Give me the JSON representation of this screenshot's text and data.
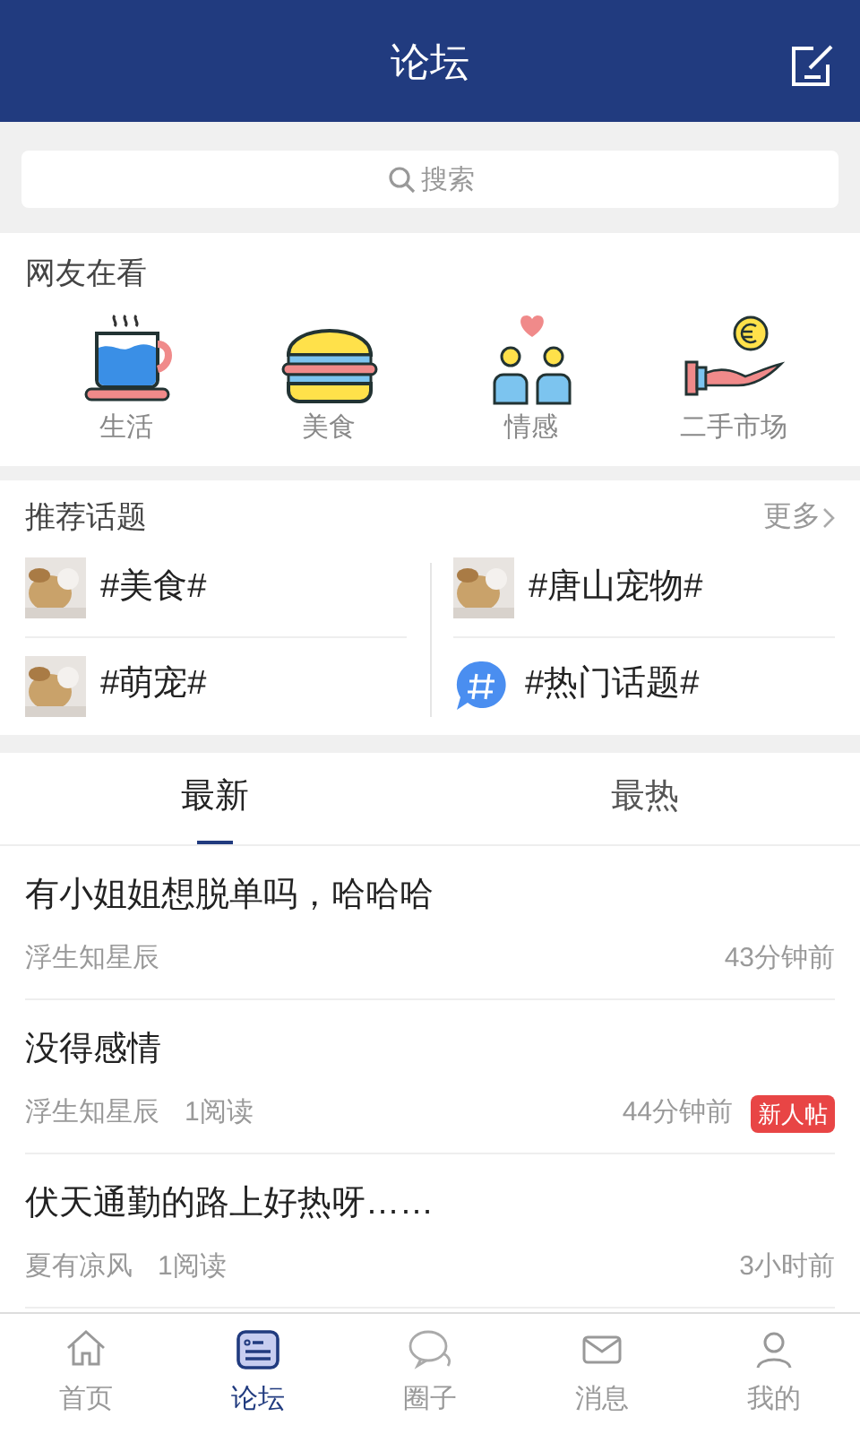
{
  "header": {
    "title": "论坛"
  },
  "search": {
    "placeholder": "搜索"
  },
  "watching": {
    "title": "网友在看",
    "items": [
      {
        "label": "生活",
        "kind": "cup"
      },
      {
        "label": "美食",
        "kind": "burger"
      },
      {
        "label": "情感",
        "kind": "couple"
      },
      {
        "label": "二手市场",
        "kind": "coin"
      }
    ]
  },
  "topics": {
    "title": "推荐话题",
    "more": "更多",
    "items": [
      {
        "label": "#美食#",
        "kind": "picture"
      },
      {
        "label": "#唐山宠物#",
        "kind": "picture"
      },
      {
        "label": "#萌宠#",
        "kind": "picture"
      },
      {
        "label": "#热门话题#",
        "kind": "hash"
      }
    ]
  },
  "tabs": [
    {
      "label": "最新",
      "selected": true
    },
    {
      "label": "最热",
      "selected": false
    }
  ],
  "posts": [
    {
      "title": "有小姐姐想脱单吗，哈哈哈",
      "author": "浮生知星辰",
      "time": "43分钟前"
    },
    {
      "title": "没得感情",
      "author": "浮生知星辰",
      "reads": "1阅读",
      "time": "44分钟前",
      "badge": "新人帖"
    },
    {
      "title": "伏天通勤的路上好热呀……",
      "author": "夏有凉风",
      "reads": "1阅读",
      "time": "3小时前"
    }
  ],
  "nav": [
    {
      "label": "首页",
      "kind": "home",
      "selected": false
    },
    {
      "label": "论坛",
      "kind": "forum",
      "selected": true
    },
    {
      "label": "圈子",
      "kind": "chat",
      "selected": false
    },
    {
      "label": "消息",
      "kind": "message",
      "selected": false
    },
    {
      "label": "我的",
      "kind": "user",
      "selected": false
    }
  ]
}
